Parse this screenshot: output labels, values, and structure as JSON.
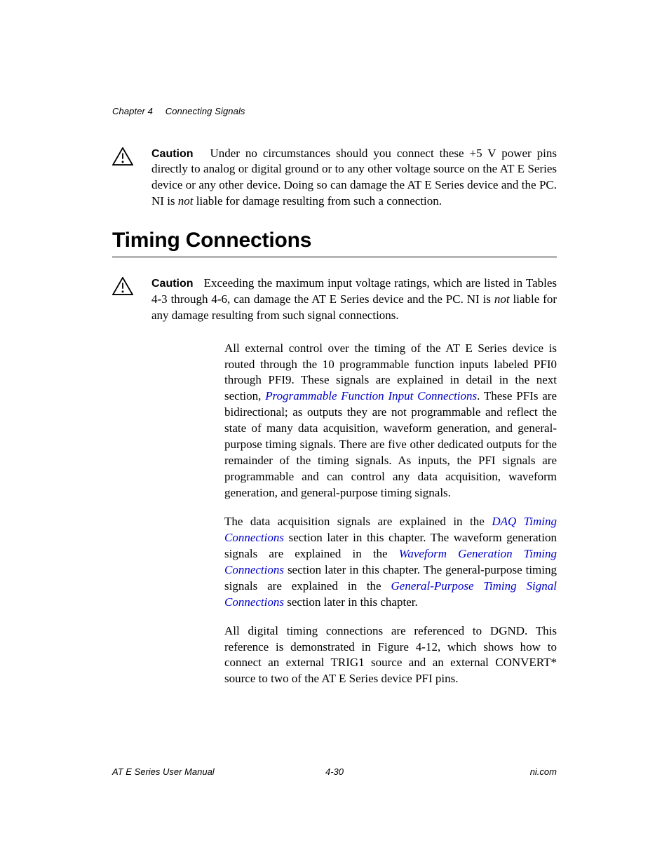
{
  "header": {
    "chapter_label": "Chapter 4",
    "chapter_title": "Connecting Signals"
  },
  "caution1": {
    "label": "Caution",
    "text_before_not": "Under no circumstances should you connect these +5 V power pins directly to analog or digital ground or to any other voltage source on the AT E Series device or any other device. Doing so can damage the AT E Series device and the PC. NI is ",
    "not_word": "not",
    "text_after_not": " liable for damage resulting from such a connection."
  },
  "section_heading": "Timing Connections",
  "caution2": {
    "label": "Caution",
    "text_before_not": "Exceeding the maximum input voltage ratings, which are listed in Tables 4-3 through 4-6, can damage the AT E Series device and the PC. NI is ",
    "not_word": "not",
    "text_after_not": " liable for any damage resulting from such signal connections."
  },
  "body1": {
    "before_link": "All external control over the timing of the AT E Series device is routed through the 10 programmable function inputs labeled PFI0 through PFI9. These signals are explained in detail in the next section, ",
    "link": "Programmable Function Input Connections",
    "after_link": ". These PFIs are bidirectional; as outputs they are not programmable and reflect the state of many data acquisition, waveform generation, and general-purpose timing signals. There are five other dedicated outputs for the remainder of the timing signals. As inputs, the PFI signals are programmable and can control any data acquisition, waveform generation, and general-purpose timing signals."
  },
  "body2": {
    "s1_before": "The data acquisition signals are explained in the ",
    "link1": "DAQ Timing Connections",
    "s1_after": " section later in this chapter. The waveform generation signals are explained in the ",
    "link2": "Waveform Generation Timing Connections",
    "s2_after": " section later in this chapter. The general-purpose timing signals are explained in the ",
    "link3": "General-Purpose Timing Signal Connections",
    "s3_after": " section later in this chapter."
  },
  "body3": "All digital timing connections are referenced to DGND. This reference is demonstrated in Figure 4-12, which shows how to connect an external TRIG1 source and an external CONVERT* source to two of the AT E Series device PFI pins.",
  "footer": {
    "left": "AT E Series User Manual",
    "center": "4-30",
    "right": "ni.com"
  }
}
